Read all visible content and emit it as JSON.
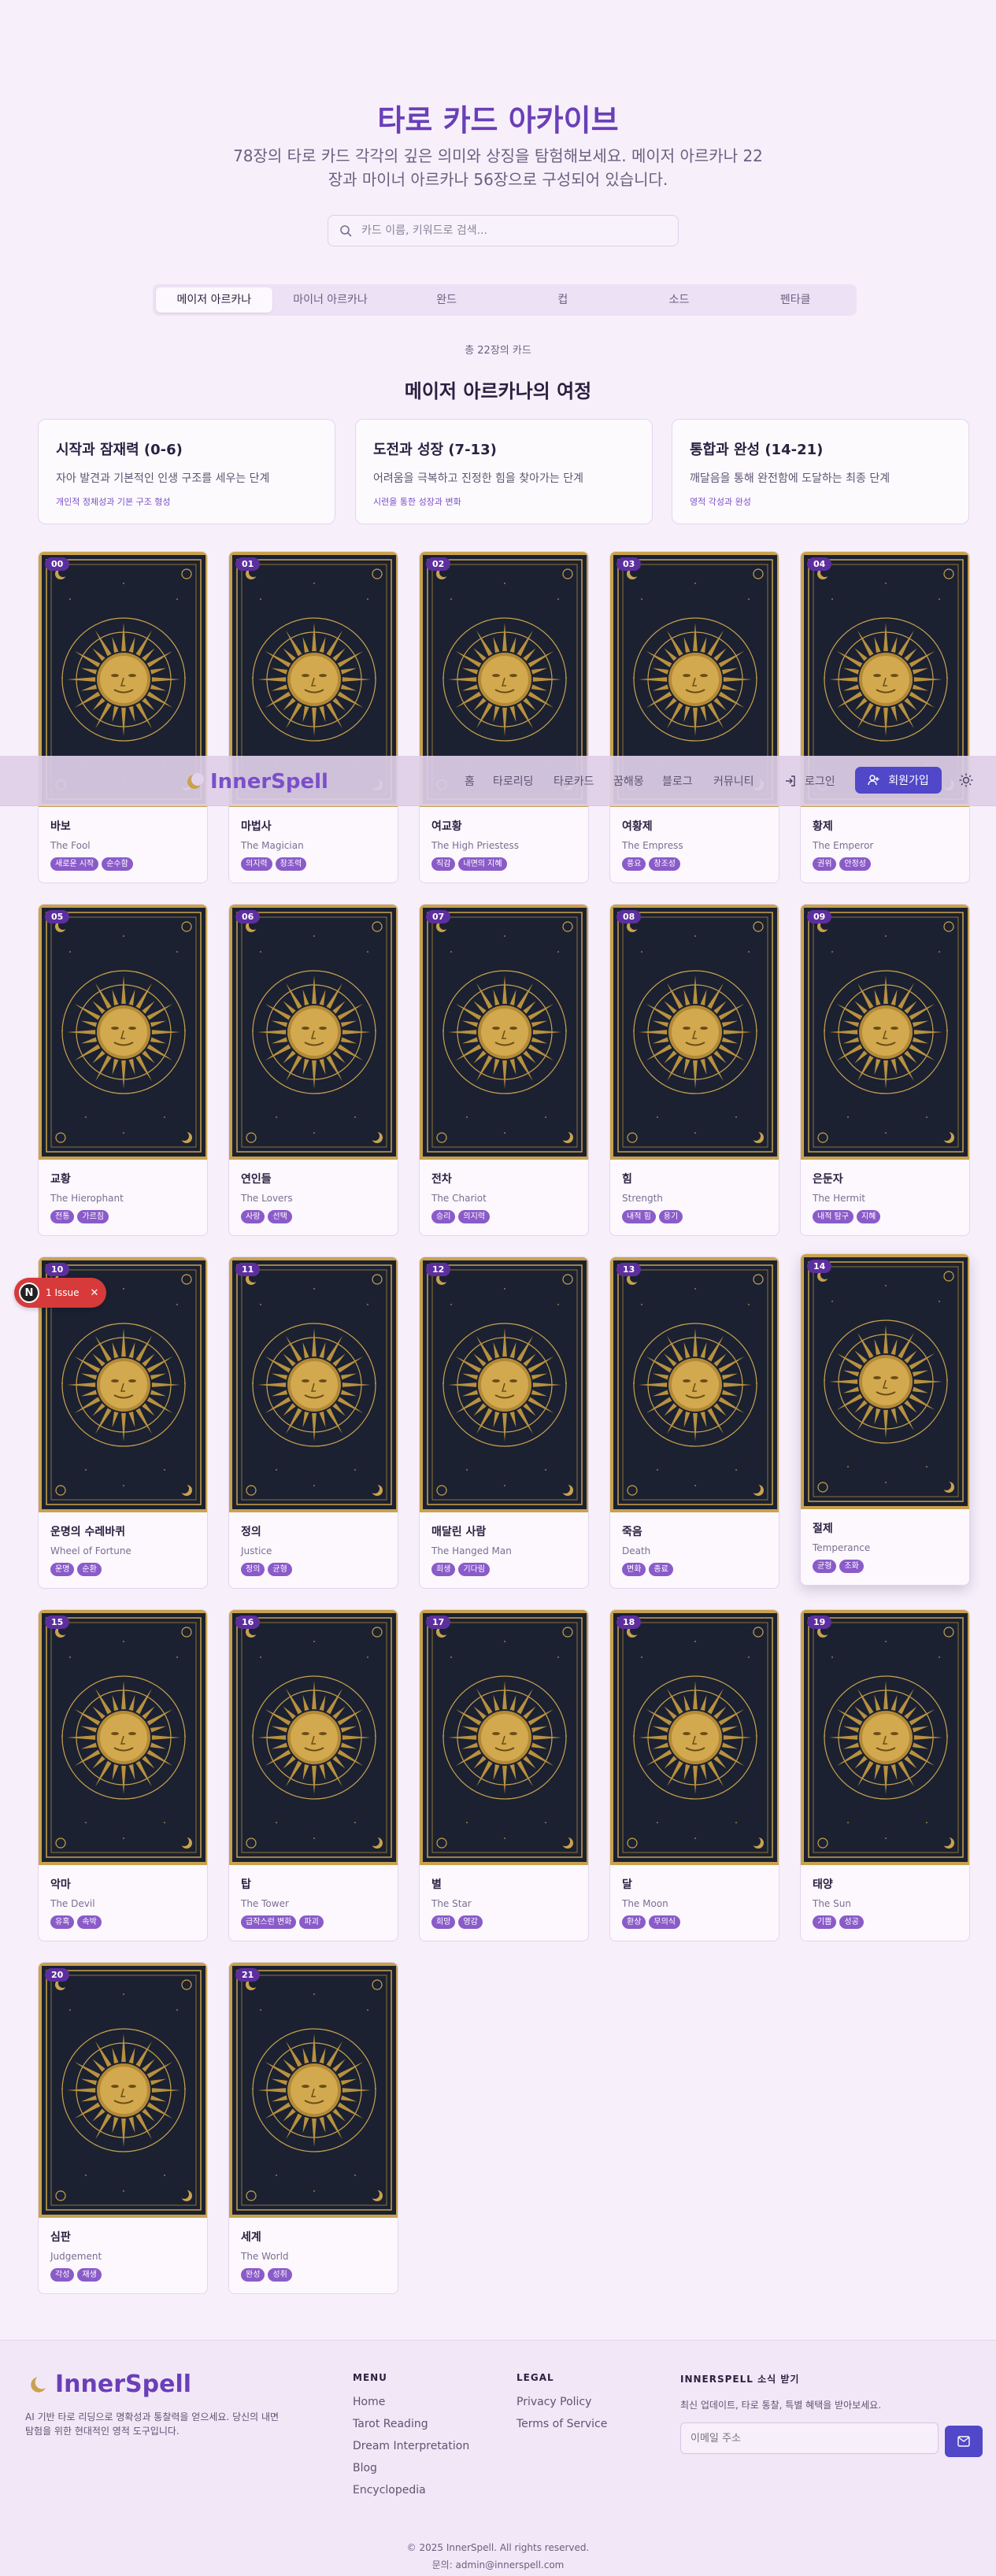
{
  "hero": {
    "title": "타로 카드 아카이브",
    "description": "78장의 타로 카드 각각의 깊은 의미와 상징을 탐험해보세요. 메이저 아르카나 22장과 마이너 아르카나 56장으로 구성되어 있습니다.",
    "search_placeholder": "카드 이름, 키워드로 검색..."
  },
  "tabs": [
    "메이저 아르카나",
    "마이너 아르카나",
    "완드",
    "컵",
    "소드",
    "펜타클"
  ],
  "active_tab": 0,
  "count_text": "총 22장의 카드",
  "section_title": "메이저 아르카나의 여정",
  "journey": [
    {
      "title": "시작과 잠재력 (0-6)",
      "desc": "자아 발견과 기본적인 인생 구조를 세우는 단계",
      "tags": "개인적 정체성과 기본 구조 형성"
    },
    {
      "title": "도전과 성장 (7-13)",
      "desc": "어려움을 극복하고 진정한 힘을 찾아가는 단계",
      "tags": "시련을 통한 성장과 변화"
    },
    {
      "title": "통합과 완성 (14-21)",
      "desc": "깨달음을 통해 완전함에 도달하는 최종 단계",
      "tags": "영적 각성과 완성"
    }
  ],
  "cards": [
    {
      "num": "00",
      "ko": "바보",
      "en": "The Fool",
      "tags": [
        "새로운 시작",
        "순수함"
      ]
    },
    {
      "num": "01",
      "ko": "마법사",
      "en": "The Magician",
      "tags": [
        "의지력",
        "창조력"
      ]
    },
    {
      "num": "02",
      "ko": "여교황",
      "en": "The High Priestess",
      "tags": [
        "직감",
        "내면의 지혜"
      ]
    },
    {
      "num": "03",
      "ko": "여황제",
      "en": "The Empress",
      "tags": [
        "풍요",
        "창조성"
      ]
    },
    {
      "num": "04",
      "ko": "황제",
      "en": "The Emperor",
      "tags": [
        "권위",
        "안정성"
      ]
    },
    {
      "num": "05",
      "ko": "교황",
      "en": "The Hierophant",
      "tags": [
        "전통",
        "가르침"
      ]
    },
    {
      "num": "06",
      "ko": "연인들",
      "en": "The Lovers",
      "tags": [
        "사랑",
        "선택"
      ]
    },
    {
      "num": "07",
      "ko": "전차",
      "en": "The Chariot",
      "tags": [
        "승리",
        "의지력"
      ]
    },
    {
      "num": "08",
      "ko": "힘",
      "en": "Strength",
      "tags": [
        "내적 힘",
        "용기"
      ]
    },
    {
      "num": "09",
      "ko": "은둔자",
      "en": "The Hermit",
      "tags": [
        "내적 탐구",
        "지혜"
      ]
    },
    {
      "num": "10",
      "ko": "운명의 수레바퀴",
      "en": "Wheel of Fortune",
      "tags": [
        "운명",
        "순환"
      ]
    },
    {
      "num": "11",
      "ko": "정의",
      "en": "Justice",
      "tags": [
        "정의",
        "균형"
      ]
    },
    {
      "num": "12",
      "ko": "매달린 사람",
      "en": "The Hanged Man",
      "tags": [
        "희생",
        "기다림"
      ]
    },
    {
      "num": "13",
      "ko": "죽음",
      "en": "Death",
      "tags": [
        "변화",
        "종료"
      ]
    },
    {
      "num": "14",
      "ko": "절제",
      "en": "Temperance",
      "tags": [
        "균형",
        "조화"
      ]
    },
    {
      "num": "15",
      "ko": "악마",
      "en": "The Devil",
      "tags": [
        "유혹",
        "속박"
      ]
    },
    {
      "num": "16",
      "ko": "탑",
      "en": "The Tower",
      "tags": [
        "급작스런 변화",
        "파괴"
      ]
    },
    {
      "num": "17",
      "ko": "별",
      "en": "The Star",
      "tags": [
        "희망",
        "영감"
      ]
    },
    {
      "num": "18",
      "ko": "달",
      "en": "The Moon",
      "tags": [
        "환상",
        "무의식"
      ]
    },
    {
      "num": "19",
      "ko": "태양",
      "en": "The Sun",
      "tags": [
        "기쁨",
        "성공"
      ]
    },
    {
      "num": "20",
      "ko": "심판",
      "en": "Judgement",
      "tags": [
        "각성",
        "재생"
      ]
    },
    {
      "num": "21",
      "ko": "세계",
      "en": "The World",
      "tags": [
        "완성",
        "성취"
      ]
    }
  ],
  "navbar": {
    "logo": "InnerSpell",
    "links": [
      "홈",
      "타로리딩",
      "타로카드",
      "꿈해몽",
      "블로그",
      "커뮤니티"
    ],
    "login": "로그인",
    "signup": "회원가입"
  },
  "issue_badge": {
    "letter": "N",
    "text": "1 Issue"
  },
  "footer": {
    "logo": "InnerSpell",
    "description": "AI 기반 타로 리딩으로 명확성과 통찰력을 얻으세요. 당신의 내면 탐험을 위한 현대적인 영적 도구입니다.",
    "menu_head": "MENU",
    "menu": [
      "Home",
      "Tarot Reading",
      "Dream Interpretation",
      "Blog",
      "Encyclopedia"
    ],
    "legal_head": "LEGAL",
    "legal": [
      "Privacy Policy",
      "Terms of Service"
    ],
    "news_head": "INNERSPELL 소식 받기",
    "news_desc": "최신 업데이트, 타로 통찰, 특별 혜택을 받아보세요.",
    "email_placeholder": "이메일 주소",
    "copyright": "© 2025 InnerSpell. All rights reserved.",
    "contact": "문의: admin@innerspell.com"
  },
  "colors": {
    "accent": "#6a3fb8",
    "primary_button": "#5147c9",
    "tag": "#8a5bc9",
    "card_dark": "#1c2234",
    "card_gold": "#c9a24e"
  }
}
